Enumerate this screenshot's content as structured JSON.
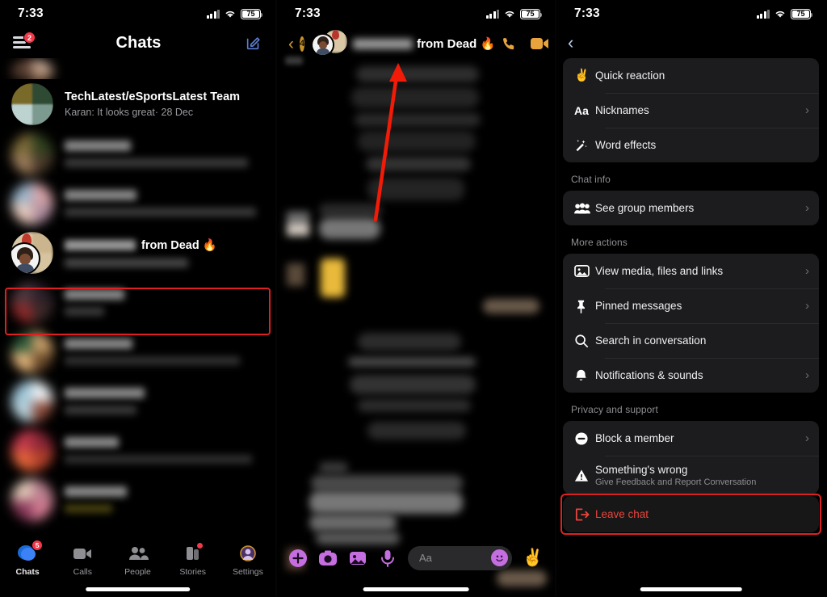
{
  "statusbar": {
    "time": "7:33",
    "battery": "75"
  },
  "left_panel": {
    "title": "Chats",
    "menu_badge": "2",
    "visible_chat": {
      "name": "TechLatest/eSportsLatest Team",
      "snippet": "Karan: It looks great· 28 Dec"
    },
    "selected_chat": {
      "name_suffix": "from Dead 🔥",
      "name_redacted": true
    },
    "tabs": [
      {
        "label": "Chats",
        "icon": "chat-bubble-icon",
        "badge": "5",
        "active": true
      },
      {
        "label": "Calls",
        "icon": "video-camera-icon",
        "badge": "",
        "active": false
      },
      {
        "label": "People",
        "icon": "people-icon",
        "badge": "",
        "active": false
      },
      {
        "label": "Stories",
        "icon": "stories-icon",
        "badge": "dot",
        "active": false
      },
      {
        "label": "Settings",
        "icon": "settings-avatar-icon",
        "badge": "",
        "active": false
      }
    ]
  },
  "middle_panel": {
    "back_count": "4",
    "title_suffix": "from Dead 🔥",
    "call_icon": "phone-icon",
    "video_icon": "video-camera-icon",
    "composer": {
      "placeholder": "Aa",
      "plus_icon": "plus-circle-icon",
      "camera_icon": "camera-icon",
      "gallery_icon": "image-icon",
      "mic_icon": "microphone-icon",
      "emoji_icon": "smiley-icon",
      "sticker_icon": "peace-hand-icon"
    }
  },
  "right_panel": {
    "back_icon": "chevron-left-icon",
    "sections": [
      {
        "label": "",
        "items": [
          {
            "icon": "peace-hand-icon",
            "title": "Quick reaction",
            "sub": "",
            "chevron": false
          },
          {
            "icon": "aa-text-icon",
            "title": "Nicknames",
            "sub": "",
            "chevron": true
          },
          {
            "icon": "magic-wand-icon",
            "title": "Word effects",
            "sub": "",
            "chevron": false
          }
        ]
      },
      {
        "label": "Chat info",
        "items": [
          {
            "icon": "group-people-icon",
            "title": "See group members",
            "sub": "",
            "chevron": true
          }
        ]
      },
      {
        "label": "More actions",
        "items": [
          {
            "icon": "media-image-icon",
            "title": "View media, files and links",
            "sub": "",
            "chevron": true
          },
          {
            "icon": "pin-icon",
            "title": "Pinned messages",
            "sub": "",
            "chevron": true
          },
          {
            "icon": "search-icon",
            "title": "Search in conversation",
            "sub": "",
            "chevron": false
          },
          {
            "icon": "bell-icon",
            "title": "Notifications & sounds",
            "sub": "",
            "chevron": true
          }
        ]
      },
      {
        "label": "Privacy and support",
        "items": [
          {
            "icon": "block-circle-icon",
            "title": "Block a member",
            "sub": "",
            "chevron": true
          },
          {
            "icon": "warning-triangle-icon",
            "title": "Something's wrong",
            "sub": "Give Feedback and Report Conversation",
            "chevron": false
          }
        ]
      }
    ],
    "leave_chat": {
      "icon": "exit-door-icon",
      "title": "Leave chat"
    }
  },
  "colors": {
    "accent_red": "#e02020",
    "danger_text": "#e8453c",
    "card_bg": "#1c1c1e",
    "muted_text": "#8e8e93",
    "gold": "#c9922b",
    "purple": "#c56ee0"
  }
}
